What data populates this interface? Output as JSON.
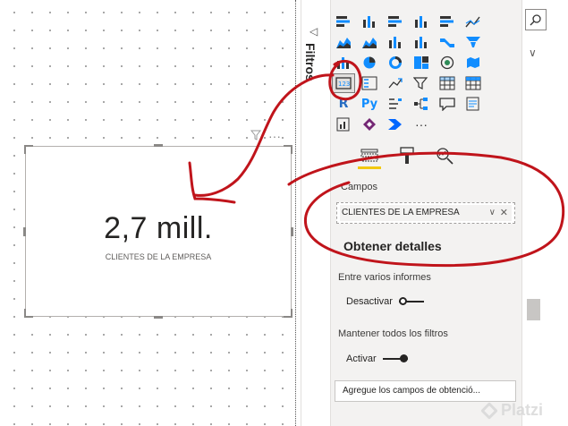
{
  "canvas": {
    "card": {
      "value": "2,7 mill.",
      "label": "CLIENTES DE LA EMPRESA"
    },
    "visual_menu": "···"
  },
  "filters": {
    "label": "Filtros",
    "collapse_icon": "collapse-left-icon"
  },
  "visualizations": {
    "icons": [
      "stacked-bar-chart-icon",
      "stacked-column-chart-icon",
      "clustered-bar-chart-icon",
      "clustered-column-chart-icon",
      "100-stacked-bar-chart-icon",
      "line-chart-icon",
      "area-chart-icon",
      "stacked-area-chart-icon",
      "line-clustered-column-chart-icon",
      "line-stacked-column-chart-icon",
      "ribbon-chart-icon",
      "funnel-chart-icon",
      "waterfall-chart-icon",
      "pie-chart-icon",
      "donut-chart-icon",
      "treemap-icon",
      "map-icon",
      "filled-map-icon",
      "card-icon",
      "multi-row-card-icon",
      "kpi-icon",
      "slicer-icon",
      "table-icon",
      "matrix-icon",
      "python-visual-icon",
      "key-influencers-icon",
      "decomposition-tree-icon",
      "qa-icon",
      "smart-narrative-icon",
      "paginated-report-icon",
      "power-apps-icon",
      "power-automate-icon",
      "more-visuals-icon"
    ],
    "r_label": "R",
    "py_label": "Py",
    "more_label": "···",
    "tabs": [
      "fields-tab-icon",
      "format-tab-icon",
      "analytics-tab-icon"
    ],
    "fields_section_label": "Campos",
    "field_chip": "CLIENTES DE LA EMPRESA",
    "drillthrough_heading": "Obtener detalles",
    "cross_report": {
      "label": "Entre varios informes",
      "toggle_text": "Desactivar"
    },
    "keep_filters": {
      "label": "Mantener todos los filtros",
      "toggle_text": "Activar"
    },
    "add_fields_button": "Agregue los campos de obtenció..."
  },
  "fields_pane": {
    "search_icon": "search-icon",
    "chevron": "chevron-down-icon"
  },
  "watermark": "Platzi",
  "colors": {
    "accent_yellow": "#f2c811",
    "annotation_red": "#c0141b",
    "pbi_blue": "#118dff"
  }
}
